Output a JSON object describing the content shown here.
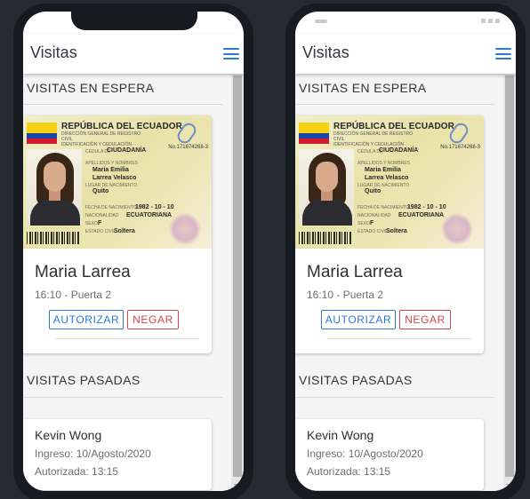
{
  "app": {
    "title": "Visitas"
  },
  "sections": {
    "waiting_title": "VISITAS EN ESPERA",
    "past_title": "VISITAS PASADAS"
  },
  "id_card": {
    "country": "REPÚBLICA DEL ECUADOR",
    "issuer_line1": "DIRECCIÓN GENERAL DE REGISTRO CIVIL",
    "issuer_line2": "IDENTIFICACIÓN Y CEDULACIÓN",
    "doc_type_label": "CÉDULA DE",
    "doc_type": "CIUDADANÍA",
    "number": "No.171674268-3",
    "names_label": "APELLIDOS Y NOMBRES",
    "names_line1": "Maria Emilia",
    "names_line2": "Larrea Velasco",
    "birthplace_label": "LUGAR DE NACIMIENTO",
    "birthplace": "Quito",
    "birthdate_label": "FECHA DE NACIMIENTO",
    "birthdate": "1982 - 10 - 10",
    "nationality_label": "NACIONALIDAD",
    "nationality": "ECUATORIANA",
    "sex_label": "SEXO",
    "sex": "F",
    "civil_label": "ESTADO CIVIL",
    "civil": "Soltera"
  },
  "waiting_visit": {
    "name": "Maria Larrea",
    "time_gate": "16:10 - Puerta 2",
    "approve_label": "AUTORIZAR",
    "deny_label": "NEGAR"
  },
  "past_visit": {
    "name": "Kevin Wong",
    "entry": "Ingreso: 10/Agosto/2020",
    "authorized": "Autorizada: 13:15"
  },
  "colors": {
    "accent": "#2a7bd8",
    "danger": "#d9434d",
    "background": "#262b33"
  },
  "icons": {
    "menu": "hamburger-menu-icon"
  }
}
